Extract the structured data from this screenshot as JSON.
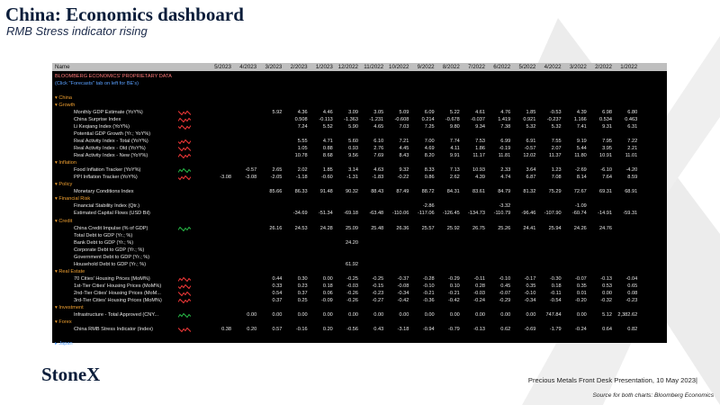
{
  "slide": {
    "title": "China: Economics dashboard",
    "subtitle": "RMB Stress indicator rising",
    "logo": "StoneX",
    "footer": "Precious Metals Front Desk Presentation, 10 May 2023|",
    "source": "Source for both charts: Bloomberg Economics"
  },
  "terminal": {
    "header_label": "Name",
    "columns": [
      "5/2023",
      "4/2023",
      "3/2023",
      "2/2023",
      "1/2023",
      "12/2022",
      "11/2022",
      "10/2022",
      "9/2022",
      "8/2022",
      "7/2022",
      "6/2022",
      "5/2022",
      "4/2022",
      "3/2022",
      "2/2022",
      "1/2022"
    ],
    "rows": [
      {
        "type": "top",
        "label": "BLOOMBERG ECONOMICS' PROPRIETARY DATA"
      },
      {
        "type": "note",
        "label": "(Click \"Forecasts\" tab on left for BE's)"
      },
      {
        "type": "blank",
        "label": ""
      },
      {
        "type": "cat",
        "label": "▾ China"
      },
      {
        "type": "cat",
        "label": "  ▾ Growth"
      },
      {
        "type": "data",
        "label": "Monthly GDP Estimate (YoY%)",
        "spark": "red",
        "values": [
          "",
          "",
          "5.92",
          "4.36",
          "4.46",
          "3.09",
          "3.05",
          "5.09",
          "6.09",
          "5.22",
          "4.61",
          "4.76",
          "1.85",
          "-0.53",
          "4.39",
          "6.98",
          "6.80"
        ]
      },
      {
        "type": "data",
        "label": "China Surprise Index",
        "spark": "red",
        "values": [
          "",
          "",
          "",
          "0.508",
          "-0.113",
          "-1.363",
          "-1.231",
          "-0.608",
          "0.214",
          "-0.678",
          "-0.037",
          "1.419",
          "0.921",
          "-0.237",
          "1.166",
          "0.534",
          "0.463"
        ]
      },
      {
        "type": "data",
        "label": "Li Keqiang Index (YoY%)",
        "spark": "red",
        "values": [
          "",
          "",
          "",
          "7.24",
          "5.52",
          "5.90",
          "4.65",
          "7.03",
          "7.25",
          "9.80",
          "9.34",
          "7.38",
          "5.32",
          "5.32",
          "7.41",
          "9.31",
          "6.31"
        ]
      },
      {
        "type": "data",
        "label": "Potential GDP Growth (Yr.; YoY%)",
        "spark": "",
        "values": [
          "",
          "",
          "",
          "",
          "",
          "",
          "",
          "",
          "",
          "",
          "",
          "",
          "",
          "",
          "",
          "",
          ""
        ]
      },
      {
        "type": "data",
        "label": "Real Activity Index - Total (YoY%)",
        "spark": "red",
        "values": [
          "",
          "",
          "",
          "5.55",
          "4.71",
          "5.60",
          "6.10",
          "7.21",
          "7.00",
          "7.74",
          "7.53",
          "6.99",
          "6.91",
          "7.55",
          "9.19",
          "7.95",
          "7.22"
        ]
      },
      {
        "type": "data",
        "label": "Real Activity Index - Old (YoY%)",
        "spark": "red",
        "values": [
          "",
          "",
          "",
          "1.05",
          "0.88",
          "0.93",
          "2.76",
          "4.45",
          "4.69",
          "4.11",
          "1.86",
          "-0.19",
          "-0.57",
          "2.07",
          "5.44",
          "3.95",
          "2.21"
        ]
      },
      {
        "type": "data",
        "label": "Real Activity Index - New (YoY%)",
        "spark": "red",
        "values": [
          "",
          "",
          "",
          "10.78",
          "8.68",
          "9.56",
          "7.69",
          "8.43",
          "8.20",
          "9.91",
          "11.17",
          "11.81",
          "12.02",
          "11.37",
          "11.80",
          "10.91",
          "11.01"
        ]
      },
      {
        "type": "cat",
        "label": "  ▾ Inflation"
      },
      {
        "type": "data",
        "label": "Food Inflation Tracker (YoY%)",
        "spark": "green",
        "values": [
          "",
          "-0.57",
          "2.65",
          "2.02",
          "1.85",
          "3.14",
          "4.63",
          "9.32",
          "8.33",
          "7.13",
          "10.93",
          "2.33",
          "3.64",
          "1.23",
          "-2.69",
          "-6.10",
          "-4.20"
        ]
      },
      {
        "type": "data",
        "label": "PPI Inflation Tracker (YoY%)",
        "spark": "red",
        "values": [
          "-3.08",
          "-3.08",
          "-2.05",
          "-1.18",
          "-0.60",
          "-1.31",
          "-1.83",
          "-0.22",
          "0.86",
          "2.62",
          "4.39",
          "4.74",
          "6.87",
          "7.08",
          "8.14",
          "7.64",
          "8.59"
        ]
      },
      {
        "type": "cat",
        "label": "  ▾ Policy"
      },
      {
        "type": "data",
        "label": "Monetary Conditions Index",
        "spark": "",
        "values": [
          "",
          "",
          "85.66",
          "86.33",
          "91.48",
          "90.32",
          "88.43",
          "87.49",
          "88.72",
          "84.31",
          "83.61",
          "84.79",
          "81.32",
          "75.29",
          "72.67",
          "69.31",
          "68.91"
        ]
      },
      {
        "type": "cat",
        "label": "  ▾ Financial Risk"
      },
      {
        "type": "data",
        "label": "Financial Stability Index (Qtr.)",
        "spark": "",
        "values": [
          "",
          "",
          "",
          "",
          "",
          "",
          "",
          "",
          "-2.86",
          "",
          "",
          "-3.32",
          "",
          "",
          "-1.09",
          "",
          ""
        ]
      },
      {
        "type": "data",
        "label": "Estimated Capital Flows (USD Bil)",
        "spark": "",
        "values": [
          "",
          "",
          "",
          "-34.69",
          "-51.34",
          "-69.18",
          "-63.48",
          "-110.06",
          "-117.06",
          "-126.45",
          "-134.73",
          "-110.79",
          "-96.46",
          "-107.90",
          "-60.74",
          "-14.91",
          "-59.31"
        ]
      },
      {
        "type": "cat",
        "label": "  ▾ Credit"
      },
      {
        "type": "data",
        "label": "China Credit Impulse (% of GDP)",
        "spark": "green",
        "values": [
          "",
          "",
          "26.16",
          "24.53",
          "24.28",
          "25.09",
          "25.48",
          "26.36",
          "25.57",
          "25.92",
          "26.75",
          "25.26",
          "24.41",
          "25.94",
          "24.26",
          "24.76",
          ""
        ]
      },
      {
        "type": "data",
        "label": "Total Debt to GDP (Yr.; %)",
        "spark": "",
        "values": [
          "",
          "",
          "",
          "",
          "",
          "",
          "",
          "",
          "",
          "",
          "",
          "",
          "",
          "",
          "",
          "",
          ""
        ]
      },
      {
        "type": "data",
        "label": "Bank Debt to GDP (Yr.; %)",
        "spark": "",
        "values": [
          "",
          "",
          "",
          "",
          "",
          "24.20",
          "",
          "",
          "",
          "",
          "",
          "",
          "",
          "",
          "",
          "",
          ""
        ]
      },
      {
        "type": "data",
        "label": "Corporate Debt to GDP (Yr.; %)",
        "spark": "",
        "values": [
          "",
          "",
          "",
          "",
          "",
          "",
          "",
          "",
          "",
          "",
          "",
          "",
          "",
          "",
          "",
          "",
          ""
        ]
      },
      {
        "type": "data",
        "label": "Government Debt to GDP (Yr.; %)",
        "spark": "",
        "values": [
          "",
          "",
          "",
          "",
          "",
          "",
          "",
          "",
          "",
          "",
          "",
          "",
          "",
          "",
          "",
          "",
          ""
        ]
      },
      {
        "type": "data",
        "label": "Household Debt to GDP (Yr.; %)",
        "spark": "",
        "values": [
          "",
          "",
          "",
          "",
          "",
          "61.92",
          "",
          "",
          "",
          "",
          "",
          "",
          "",
          "",
          "",
          "",
          ""
        ]
      },
      {
        "type": "cat",
        "label": "  ▾ Real Estate"
      },
      {
        "type": "data",
        "label": "70 Cities' Housing Prices (MoM%)",
        "spark": "red",
        "values": [
          "",
          "",
          "0.44",
          "0.30",
          "0.00",
          "-0.25",
          "-0.25",
          "-0.37",
          "-0.28",
          "-0.29",
          "-0.11",
          "-0.10",
          "-0.17",
          "-0.30",
          "-0.07",
          "-0.13",
          "-0.04"
        ]
      },
      {
        "type": "data",
        "label": "1st-Tier Cities' Housing Prices (MoM%)",
        "spark": "red",
        "values": [
          "",
          "",
          "0.33",
          "0.23",
          "0.18",
          "-0.03",
          "-0.15",
          "-0.08",
          "-0.10",
          "0.10",
          "0.28",
          "0.45",
          "0.35",
          "0.18",
          "0.35",
          "0.53",
          "0.65"
        ]
      },
      {
        "type": "data",
        "label": "2nd-Tier Cities' Housing Prices (MoM...",
        "spark": "red",
        "values": [
          "",
          "",
          "0.54",
          "0.37",
          "0.06",
          "-0.26",
          "-0.23",
          "-0.34",
          "-0.21",
          "-0.21",
          "-0.03",
          "-0.07",
          "-0.10",
          "-0.11",
          "0.01",
          "0.00",
          "0.08"
        ]
      },
      {
        "type": "data",
        "label": "3rd-Tier Cities' Housing Prices (MoM%)",
        "spark": "red",
        "values": [
          "",
          "",
          "0.37",
          "0.25",
          "-0.09",
          "-0.26",
          "-0.27",
          "-0.42",
          "-0.36",
          "-0.42",
          "-0.24",
          "-0.29",
          "-0.34",
          "-0.54",
          "-0.20",
          "-0.32",
          "-0.23"
        ]
      },
      {
        "type": "cat",
        "label": "  ▾ Investment"
      },
      {
        "type": "data",
        "label": "Infrastructure - Total Approved (CNY...",
        "spark": "green",
        "values": [
          "",
          "0.00",
          "0.00",
          "0.00",
          "0.00",
          "0.00",
          "0.00",
          "0.00",
          "0.00",
          "0.00",
          "0.00",
          "0.00",
          "0.00",
          "747.84",
          "0.00",
          "5.12",
          "2,382.62"
        ]
      },
      {
        "type": "cat",
        "label": "  ▾ Forex"
      },
      {
        "type": "data",
        "label": "China RMB Stress Indicator (Index)",
        "spark": "red",
        "values": [
          "0.38",
          "0.20",
          "0.57",
          "-0.16",
          "0.20",
          "-0.56",
          "0.43",
          "-3.18",
          "-0.94",
          "-0.79",
          "-0.13",
          "0.62",
          "-0.69",
          "-1.79",
          "-0.24",
          "0.64",
          "0.82"
        ]
      },
      {
        "type": "blank",
        "label": ""
      },
      {
        "type": "note",
        "label": "▸ Japan"
      }
    ]
  }
}
